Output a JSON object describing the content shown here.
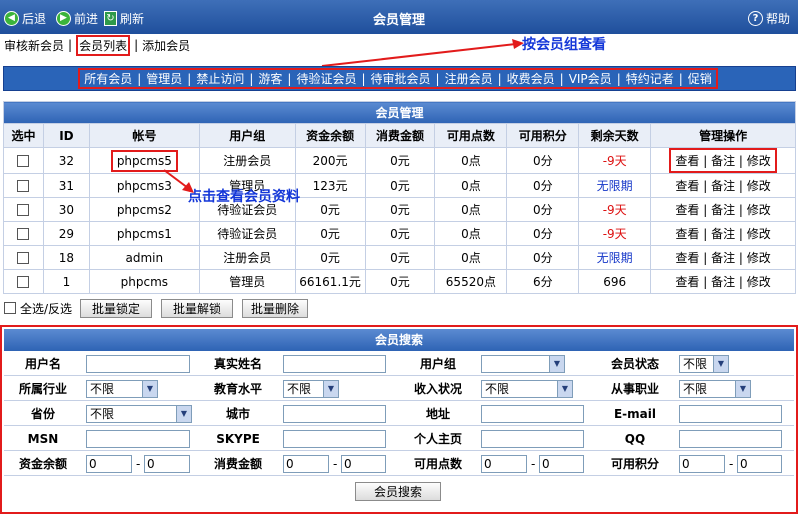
{
  "toolbar": {
    "back": "后退",
    "forward": "前进",
    "refresh": "刷新",
    "title": "会员管理",
    "help": "帮助"
  },
  "subnav": {
    "review": "审核新会员",
    "list": "会员列表",
    "add": "添加会员"
  },
  "annotations": {
    "by_group": "按会员组查看",
    "view_profile": "点击查看会员资料"
  },
  "categories": [
    "所有会员",
    "管理员",
    "禁止访问",
    "游客",
    "待验证会员",
    "待审批会员",
    "注册会员",
    "收费会员",
    "VIP会员",
    "特约记者",
    "促销"
  ],
  "member_table": {
    "caption": "会员管理",
    "headers": [
      "选中",
      "ID",
      "帐号",
      "用户组",
      "资金余额",
      "消费金额",
      "可用点数",
      "可用积分",
      "剩余天数",
      "管理操作"
    ],
    "rows": [
      {
        "id": "32",
        "account": "phpcms5",
        "group": "注册会员",
        "balance": "200元",
        "spent": "0元",
        "points": "0点",
        "credits": "0分",
        "days": "-9天",
        "days_color": "#dd1111"
      },
      {
        "id": "31",
        "account": "phpcms3",
        "group": "管理员",
        "balance": "123元",
        "spent": "0元",
        "points": "0点",
        "credits": "0分",
        "days": "无限期",
        "days_color": "#1436c8"
      },
      {
        "id": "30",
        "account": "phpcms2",
        "group": "待验证会员",
        "balance": "0元",
        "spent": "0元",
        "points": "0点",
        "credits": "0分",
        "days": "-9天",
        "days_color": "#dd1111"
      },
      {
        "id": "29",
        "account": "phpcms1",
        "group": "待验证会员",
        "balance": "0元",
        "spent": "0元",
        "points": "0点",
        "credits": "0分",
        "days": "-9天",
        "days_color": "#dd1111"
      },
      {
        "id": "18",
        "account": "admin",
        "group": "注册会员",
        "balance": "0元",
        "spent": "0元",
        "points": "0点",
        "credits": "0分",
        "days": "无限期",
        "days_color": "#1436c8"
      },
      {
        "id": "1",
        "account": "phpcms",
        "group": "管理员",
        "balance": "66161.1元",
        "spent": "0元",
        "points": "65520点",
        "credits": "6分",
        "days": "696",
        "days_color": "#000000"
      }
    ],
    "ops": {
      "view": "查看",
      "note": "备注",
      "edit": "修改",
      "sep": "|"
    }
  },
  "batch": {
    "select_all": "全选/反选",
    "lock": "批量锁定",
    "unlock": "批量解锁",
    "delete": "批量删除"
  },
  "search": {
    "caption": "会员搜索",
    "row1": {
      "username": "用户名",
      "realname": "真实姓名",
      "group": "用户组",
      "status": "会员状态",
      "status_value": "不限"
    },
    "row2": {
      "industry": "所属行业",
      "industry_value": "不限",
      "education": "教育水平",
      "education_value": "不限",
      "income": "收入状况",
      "income_value": "不限",
      "occupation": "从事职业",
      "occupation_value": "不限"
    },
    "row3": {
      "province": "省份",
      "province_value": "不限",
      "city": "城市",
      "address": "地址",
      "email": "E-mail"
    },
    "row4": {
      "msn": "MSN",
      "skype": "SKYPE",
      "homepage": "个人主页",
      "qq": "QQ"
    },
    "row5": {
      "balance": "资金余额",
      "spent": "消费金额",
      "points": "可用点数",
      "credits": "可用积分",
      "min": "0",
      "max": "0",
      "dash": "-"
    },
    "submit": "会员搜索"
  },
  "colors": {
    "accent_blue": "#2a64b8",
    "annotation_blue": "#1437d8",
    "highlight_red": "#e21b1b"
  }
}
